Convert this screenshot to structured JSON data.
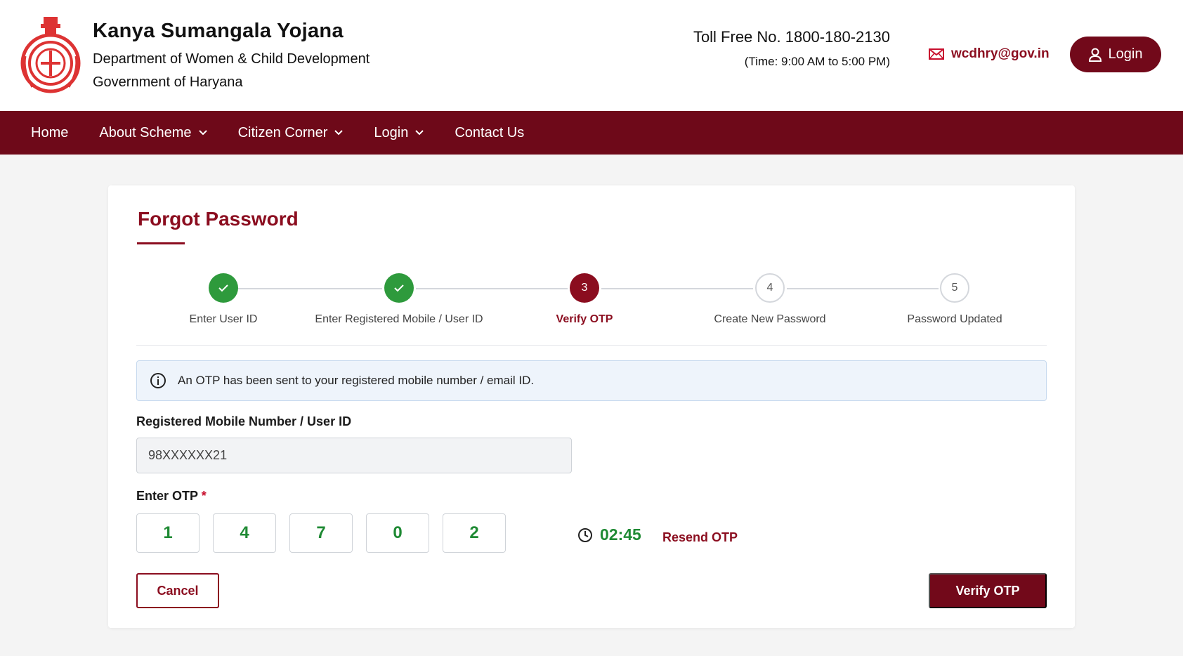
{
  "header": {
    "title": "Kanya Sumangala Yojana",
    "department": "Department of Women & Child Development",
    "government": "Government of Haryana",
    "toll_free": "Toll Free No. 1800-180-2130",
    "toll_time": "(Time: 9:00 AM to 5:00 PM)",
    "email": "wcdhry@gov.in",
    "login_label": "Login",
    "accent_color": "#72091a"
  },
  "nav": {
    "items": [
      {
        "label": "Home"
      },
      {
        "label": "About Scheme"
      },
      {
        "label": "Citizen Corner"
      },
      {
        "label": "Login"
      },
      {
        "label": "Contact Us"
      }
    ]
  },
  "form": {
    "title": "Forgot Password",
    "steps": [
      {
        "label": "Enter User ID",
        "state": "done",
        "number": "1"
      },
      {
        "label": "Enter Registered Mobile / User ID",
        "state": "done",
        "number": "2"
      },
      {
        "label": "Verify OTP",
        "state": "active",
        "number": "3"
      },
      {
        "label": "Create New Password",
        "state": "todo",
        "number": "4"
      },
      {
        "label": "Password Updated",
        "state": "todo",
        "number": "5"
      }
    ],
    "info_message": "An OTP has been sent to your registered mobile number / email ID.",
    "mobile_label": "Registered Mobile Number / User ID",
    "mobile_value": "98XXXXXX21",
    "otp_label": "Enter OTP",
    "required_marker": "*",
    "otp_digits": [
      "1",
      "4",
      "7",
      "0",
      "2"
    ],
    "timer": "02:45",
    "resend_label": "Resend OTP",
    "cancel_label": "Cancel",
    "verify_label": "Verify OTP"
  }
}
